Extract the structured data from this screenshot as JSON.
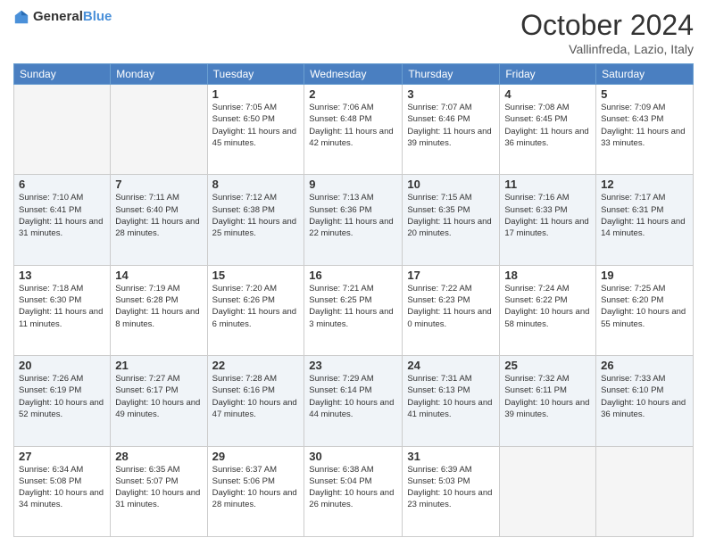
{
  "header": {
    "logo_general": "General",
    "logo_blue": "Blue",
    "month": "October 2024",
    "location": "Vallinfreda, Lazio, Italy"
  },
  "days_of_week": [
    "Sunday",
    "Monday",
    "Tuesday",
    "Wednesday",
    "Thursday",
    "Friday",
    "Saturday"
  ],
  "weeks": [
    [
      null,
      null,
      {
        "day": 1,
        "sunrise": "Sunrise: 7:05 AM",
        "sunset": "Sunset: 6:50 PM",
        "daylight": "Daylight: 11 hours and 45 minutes."
      },
      {
        "day": 2,
        "sunrise": "Sunrise: 7:06 AM",
        "sunset": "Sunset: 6:48 PM",
        "daylight": "Daylight: 11 hours and 42 minutes."
      },
      {
        "day": 3,
        "sunrise": "Sunrise: 7:07 AM",
        "sunset": "Sunset: 6:46 PM",
        "daylight": "Daylight: 11 hours and 39 minutes."
      },
      {
        "day": 4,
        "sunrise": "Sunrise: 7:08 AM",
        "sunset": "Sunset: 6:45 PM",
        "daylight": "Daylight: 11 hours and 36 minutes."
      },
      {
        "day": 5,
        "sunrise": "Sunrise: 7:09 AM",
        "sunset": "Sunset: 6:43 PM",
        "daylight": "Daylight: 11 hours and 33 minutes."
      }
    ],
    [
      {
        "day": 6,
        "sunrise": "Sunrise: 7:10 AM",
        "sunset": "Sunset: 6:41 PM",
        "daylight": "Daylight: 11 hours and 31 minutes."
      },
      {
        "day": 7,
        "sunrise": "Sunrise: 7:11 AM",
        "sunset": "Sunset: 6:40 PM",
        "daylight": "Daylight: 11 hours and 28 minutes."
      },
      {
        "day": 8,
        "sunrise": "Sunrise: 7:12 AM",
        "sunset": "Sunset: 6:38 PM",
        "daylight": "Daylight: 11 hours and 25 minutes."
      },
      {
        "day": 9,
        "sunrise": "Sunrise: 7:13 AM",
        "sunset": "Sunset: 6:36 PM",
        "daylight": "Daylight: 11 hours and 22 minutes."
      },
      {
        "day": 10,
        "sunrise": "Sunrise: 7:15 AM",
        "sunset": "Sunset: 6:35 PM",
        "daylight": "Daylight: 11 hours and 20 minutes."
      },
      {
        "day": 11,
        "sunrise": "Sunrise: 7:16 AM",
        "sunset": "Sunset: 6:33 PM",
        "daylight": "Daylight: 11 hours and 17 minutes."
      },
      {
        "day": 12,
        "sunrise": "Sunrise: 7:17 AM",
        "sunset": "Sunset: 6:31 PM",
        "daylight": "Daylight: 11 hours and 14 minutes."
      }
    ],
    [
      {
        "day": 13,
        "sunrise": "Sunrise: 7:18 AM",
        "sunset": "Sunset: 6:30 PM",
        "daylight": "Daylight: 11 hours and 11 minutes."
      },
      {
        "day": 14,
        "sunrise": "Sunrise: 7:19 AM",
        "sunset": "Sunset: 6:28 PM",
        "daylight": "Daylight: 11 hours and 8 minutes."
      },
      {
        "day": 15,
        "sunrise": "Sunrise: 7:20 AM",
        "sunset": "Sunset: 6:26 PM",
        "daylight": "Daylight: 11 hours and 6 minutes."
      },
      {
        "day": 16,
        "sunrise": "Sunrise: 7:21 AM",
        "sunset": "Sunset: 6:25 PM",
        "daylight": "Daylight: 11 hours and 3 minutes."
      },
      {
        "day": 17,
        "sunrise": "Sunrise: 7:22 AM",
        "sunset": "Sunset: 6:23 PM",
        "daylight": "Daylight: 11 hours and 0 minutes."
      },
      {
        "day": 18,
        "sunrise": "Sunrise: 7:24 AM",
        "sunset": "Sunset: 6:22 PM",
        "daylight": "Daylight: 10 hours and 58 minutes."
      },
      {
        "day": 19,
        "sunrise": "Sunrise: 7:25 AM",
        "sunset": "Sunset: 6:20 PM",
        "daylight": "Daylight: 10 hours and 55 minutes."
      }
    ],
    [
      {
        "day": 20,
        "sunrise": "Sunrise: 7:26 AM",
        "sunset": "Sunset: 6:19 PM",
        "daylight": "Daylight: 10 hours and 52 minutes."
      },
      {
        "day": 21,
        "sunrise": "Sunrise: 7:27 AM",
        "sunset": "Sunset: 6:17 PM",
        "daylight": "Daylight: 10 hours and 49 minutes."
      },
      {
        "day": 22,
        "sunrise": "Sunrise: 7:28 AM",
        "sunset": "Sunset: 6:16 PM",
        "daylight": "Daylight: 10 hours and 47 minutes."
      },
      {
        "day": 23,
        "sunrise": "Sunrise: 7:29 AM",
        "sunset": "Sunset: 6:14 PM",
        "daylight": "Daylight: 10 hours and 44 minutes."
      },
      {
        "day": 24,
        "sunrise": "Sunrise: 7:31 AM",
        "sunset": "Sunset: 6:13 PM",
        "daylight": "Daylight: 10 hours and 41 minutes."
      },
      {
        "day": 25,
        "sunrise": "Sunrise: 7:32 AM",
        "sunset": "Sunset: 6:11 PM",
        "daylight": "Daylight: 10 hours and 39 minutes."
      },
      {
        "day": 26,
        "sunrise": "Sunrise: 7:33 AM",
        "sunset": "Sunset: 6:10 PM",
        "daylight": "Daylight: 10 hours and 36 minutes."
      }
    ],
    [
      {
        "day": 27,
        "sunrise": "Sunrise: 6:34 AM",
        "sunset": "Sunset: 5:08 PM",
        "daylight": "Daylight: 10 hours and 34 minutes."
      },
      {
        "day": 28,
        "sunrise": "Sunrise: 6:35 AM",
        "sunset": "Sunset: 5:07 PM",
        "daylight": "Daylight: 10 hours and 31 minutes."
      },
      {
        "day": 29,
        "sunrise": "Sunrise: 6:37 AM",
        "sunset": "Sunset: 5:06 PM",
        "daylight": "Daylight: 10 hours and 28 minutes."
      },
      {
        "day": 30,
        "sunrise": "Sunrise: 6:38 AM",
        "sunset": "Sunset: 5:04 PM",
        "daylight": "Daylight: 10 hours and 26 minutes."
      },
      {
        "day": 31,
        "sunrise": "Sunrise: 6:39 AM",
        "sunset": "Sunset: 5:03 PM",
        "daylight": "Daylight: 10 hours and 23 minutes."
      },
      null,
      null
    ]
  ]
}
